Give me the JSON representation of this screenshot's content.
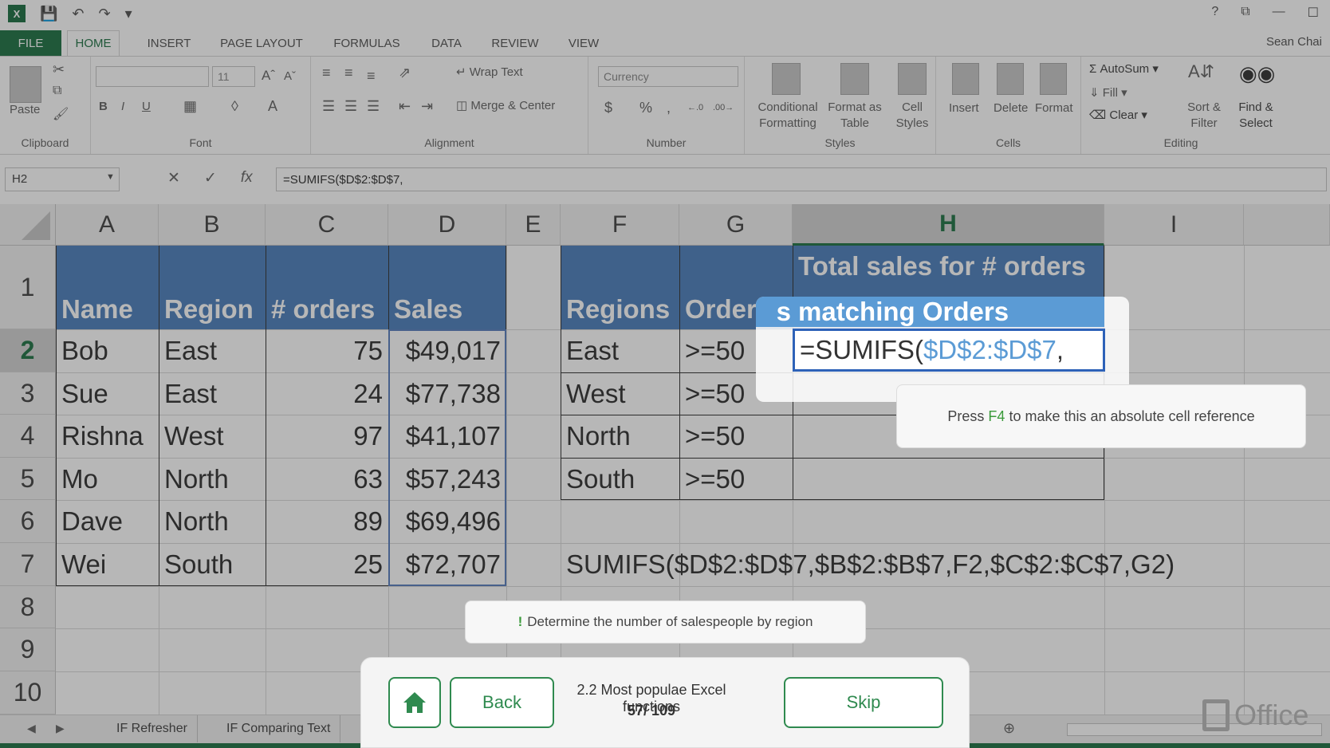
{
  "title_bar": {
    "window_controls": [
      "?",
      "⧉",
      "—",
      "☐"
    ]
  },
  "menu": {
    "file": "FILE",
    "tabs": [
      "HOME",
      "INSERT",
      "PAGE LAYOUT",
      "FORMULAS",
      "DATA",
      "REVIEW",
      "VIEW"
    ],
    "active_tab": "HOME",
    "user": "Sean Chai"
  },
  "ribbon": {
    "clipboard": {
      "label": "Clipboard",
      "paste": "Paste"
    },
    "font": {
      "label": "Font",
      "font_name": "",
      "font_size": "11",
      "bold": "B",
      "italic": "I",
      "underline": "U",
      "font_color": "A"
    },
    "alignment": {
      "label": "Alignment",
      "wrap_text": "Wrap Text",
      "merge_center": "Merge & Center"
    },
    "number": {
      "label": "Number",
      "format": "Currency",
      "currency": "$",
      "percent": "%",
      "comma": ",",
      "inc_decimal": "+.0 .00",
      "dec_decimal": ".00 →.0"
    },
    "styles": {
      "label": "Styles",
      "conditional": "Conditional\nFormatting",
      "format_table": "Format as\nTable",
      "cell_styles": "Cell\nStyles"
    },
    "cells": {
      "label": "Cells",
      "insert": "Insert",
      "delete": "Delete",
      "format": "Format"
    },
    "editing": {
      "label": "Editing",
      "autosum": "AutoSum",
      "fill": "Fill",
      "clear": "Clear",
      "sort_filter": "Sort &\nFilter",
      "find_select": "Find &\nSelect"
    }
  },
  "formula_bar": {
    "name_box": "H2",
    "formula": "=SUMIFS($D$2:$D$7,"
  },
  "columns": [
    "A",
    "B",
    "C",
    "D",
    "E",
    "F",
    "G",
    "H",
    "I"
  ],
  "rows": [
    "1",
    "2",
    "3",
    "4",
    "5",
    "6",
    "7",
    "8",
    "9",
    "10"
  ],
  "table1": {
    "headers": [
      "Name",
      "Region",
      "# orders",
      "Sales"
    ],
    "rows": [
      [
        "Bob",
        "East",
        "75",
        "$49,017"
      ],
      [
        "Sue",
        "East",
        "24",
        "$77,738"
      ],
      [
        "Rishna",
        "West",
        "97",
        "$41,107"
      ],
      [
        "Mo",
        "North",
        "63",
        "$57,243"
      ],
      [
        "Dave",
        "North",
        "89",
        "$69,496"
      ],
      [
        "Wei",
        "South",
        "25",
        "$72,707"
      ]
    ]
  },
  "table2": {
    "headers": [
      "Regions",
      "Orders"
    ],
    "h_header_line1": "Total sales for # orders",
    "h_header_line2": "matching Orders",
    "rows": [
      [
        "East",
        ">=50"
      ],
      [
        "West",
        ">=50"
      ],
      [
        "North",
        ">=50"
      ],
      [
        "South",
        ">=50"
      ]
    ],
    "active_cell_text_prefix": "=SUMIFS(",
    "active_cell_text_ref": "$D$2:$D$7",
    "active_cell_text_suffix": ","
  },
  "note_row7": "SUMIFS($D$2:$D$7,$B$2:$B$7,F2,$C$2:$C$7,G2)",
  "tooltip_f4": {
    "before": "Press ",
    "key": "F4",
    "after": " to make this an absolute cell reference"
  },
  "hint": {
    "mark": "!",
    "text": "Determine the number of salespeople by region"
  },
  "nav": {
    "home_icon": "home-icon",
    "back": "Back",
    "skip": "Skip",
    "lesson_title": "2.2 Most populae Excel functions",
    "progress": "57/ 109"
  },
  "sheet_tabs": [
    "IF Refresher",
    "IF Comparing Text"
  ],
  "brand": "Office",
  "colors": {
    "excel_green": "#217346",
    "table_header": "#4f81bd",
    "highlight_ref": "#5b9bd5"
  }
}
